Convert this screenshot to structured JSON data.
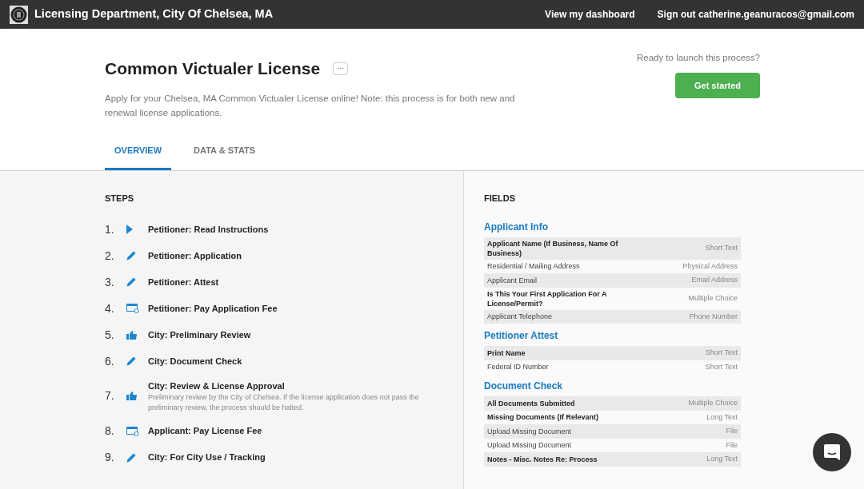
{
  "header": {
    "title": "Licensing Department, City Of Chelsea, MA",
    "links": [
      "View my dashboard",
      "Sign out catherine.geanuracos@gmail.com"
    ]
  },
  "process": {
    "title": "Common Victualer License",
    "menu_label": "···",
    "description": "Apply for your Chelsea, MA Common Victualer License online! Note: this process is for both new and renewal license applications.",
    "launch_prompt": "Ready to launch this process?",
    "start_button": "Get started"
  },
  "tabs": [
    {
      "label": "OVERVIEW",
      "selected": true
    },
    {
      "label": "DATA & STATS",
      "selected": false
    }
  ],
  "steps": {
    "heading": "STEPS",
    "items": [
      {
        "number": "1.",
        "kind": "play",
        "title": "Petitioner: Read Instructions"
      },
      {
        "number": "2.",
        "kind": "pencil",
        "title": "Petitioner: Application"
      },
      {
        "number": "3.",
        "kind": "pencil",
        "title": "Petitioner: Attest"
      },
      {
        "number": "4.",
        "kind": "payment",
        "title": "Petitioner: Pay Application Fee"
      },
      {
        "number": "5.",
        "kind": "thumb",
        "title": "City: Preliminary Review"
      },
      {
        "number": "6.",
        "kind": "pencil",
        "title": "City: Document Check"
      },
      {
        "number": "7.",
        "kind": "thumb",
        "title": "City: Review & License Approval",
        "description": "Preliminary review by the City of Chelsea. If the license application does not pass the preliminary review, the process should be halted."
      },
      {
        "number": "8.",
        "kind": "payment",
        "title": "Applicant: Pay License Fee"
      },
      {
        "number": "9.",
        "kind": "pencil",
        "title": "City: For City Use / Tracking"
      }
    ]
  },
  "fields": {
    "heading": "FIELDS",
    "groups": [
      {
        "title": "Applicant Info",
        "rows": [
          {
            "label": "Applicant Name (If Business, Name Of Business)",
            "type": "Short Text",
            "required": true
          },
          {
            "label": "Residential / Mailing Address",
            "type": "Physical Address",
            "required": false
          },
          {
            "label": "Applicant Email",
            "type": "Email Address",
            "required": false
          },
          {
            "label": "Is This Your First Application For A License/Permit?",
            "type": "Multiple Choice",
            "required": true
          },
          {
            "label": "Applicant Telephone",
            "type": "Phone Number",
            "required": false
          }
        ]
      },
      {
        "title": "Petitioner Attest",
        "rows": [
          {
            "label": "Print Name",
            "type": "Short Text",
            "required": true
          },
          {
            "label": "Federal ID Number",
            "type": "Short Text",
            "required": false
          }
        ]
      },
      {
        "title": "Document Check",
        "rows": [
          {
            "label": "All Documents Submitted",
            "type": "Multiple Choice",
            "required": true
          },
          {
            "label": "Missing Documents (If Relevant)",
            "type": "Long Text",
            "required": true
          },
          {
            "label": "Upload Missing Document",
            "type": "File",
            "required": false
          },
          {
            "label": "Upload Missing Document",
            "type": "File",
            "required": false
          },
          {
            "label": "Notes - Misc. Notes Re: Process",
            "type": "Long Text",
            "required": true
          }
        ]
      }
    ]
  }
}
